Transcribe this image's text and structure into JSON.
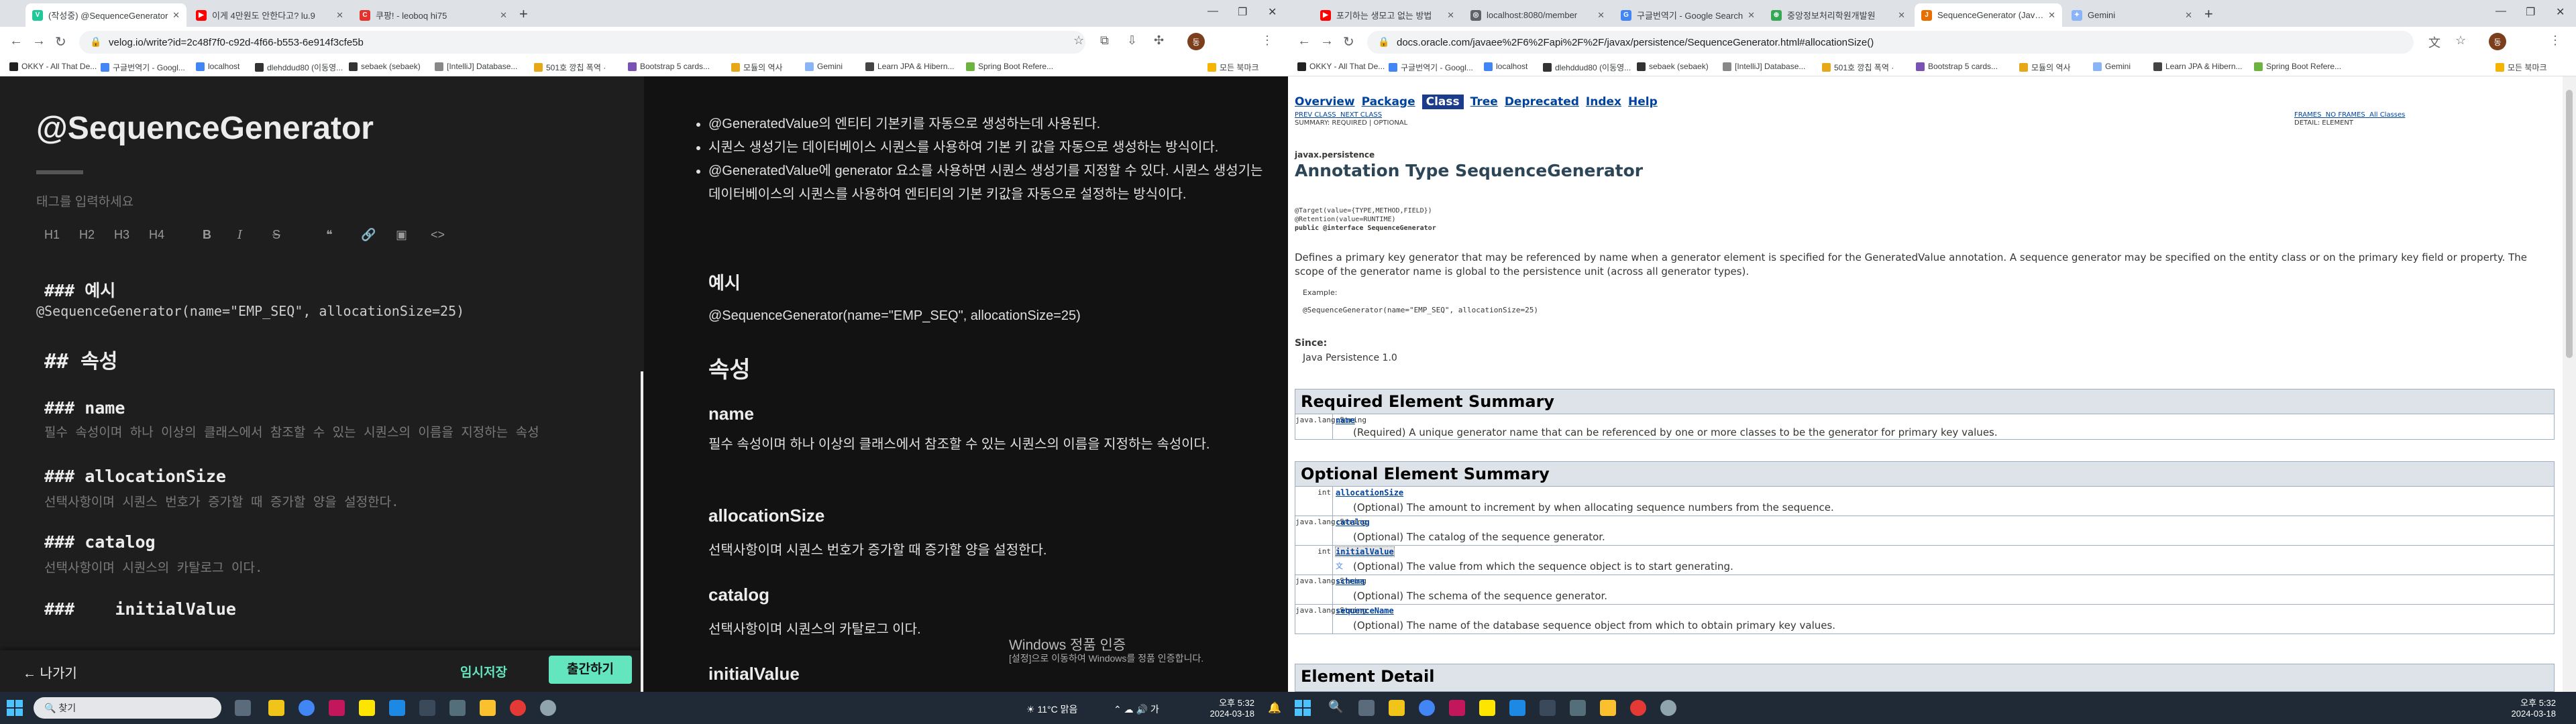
{
  "left": {
    "tabs": [
      {
        "title": "(작성중) @SequenceGenerator",
        "color": "#20c997"
      },
      {
        "title": "이게 4만원도 안한다고? lu.9",
        "color": "#ff0000"
      },
      {
        "title": "쿠팡! - leoboq hi75",
        "color": "#e4332c"
      }
    ],
    "url": "velog.io/write?id=2c48f7f0-c92d-4f66-b553-6e914f3cfe5b",
    "bookmarks": [
      "OKKY - All That De...",
      "구글번역기 - Googl...",
      "localhost",
      "dlehddud80 (이동영...",
      "sebaek (sebaek)",
      "[IntelliJ] Database...",
      "501호 깡칩 폭역 ·",
      "Bootstrap 5 cards...",
      "모듈의 역사",
      "Gemini",
      "Learn JPA & Hibern...",
      "Spring Boot Refere..."
    ],
    "all_bookmarks": "모든 북마크",
    "editor": {
      "title": "@SequenceGenerator",
      "tags_placeholder": "태그를 입력하세요",
      "toolbar": [
        "H1",
        "H2",
        "H3",
        "H4",
        "B",
        "I",
        "S",
        "❝",
        "🔗",
        "▣",
        "<>"
      ],
      "lines": [
        {
          "kind": "h3",
          "text": "### 예시"
        },
        {
          "kind": "code",
          "text": "@SequenceGenerator(name=\"EMP_SEQ\", allocationSize=25)"
        },
        {
          "kind": "h2",
          "text": "## 속성"
        },
        {
          "kind": "h3",
          "text": "### name"
        },
        {
          "kind": "body",
          "text": "필수 속성이며 하나 이상의 클래스에서 참조할 수 있는 시퀀스의 이름을 지정하는 속성"
        },
        {
          "kind": "h3",
          "text": "### allocationSize"
        },
        {
          "kind": "body",
          "text": "선택사항이며 시퀀스 번호가 증가할 때 증가할 양을 설정한다."
        },
        {
          "kind": "h3",
          "text": "### catalog"
        },
        {
          "kind": "body",
          "text": "선택사항이며 시퀀스의 카탈로그 이다."
        },
        {
          "kind": "h3",
          "text": "###    initialValue"
        }
      ],
      "exit": "나가기",
      "save": "임시저장",
      "publish": "출간하기"
    },
    "preview": {
      "bullets": [
        "@GeneratedValue의 엔티티 기본키를 자동으로 생성하는데 사용된다.",
        "시퀀스 생성기는 데이터베이스 시퀀스를 사용하여 기본 키 값을 자동으로 생성하는 방식이다.",
        "@GeneratedValue에 generator 요소를 사용하면 시퀀스 생성기를 지정할 수 있다. 시퀀스 생성기는 데이터베이스의 시퀀스를 사용하여 엔티티의 기본 키값을 자동으로 설정하는 방식이다."
      ],
      "example_heading": "예시",
      "example_code": "@SequenceGenerator(name=\"EMP_SEQ\", allocationSize=25)",
      "attr_heading": "속성",
      "sections": [
        {
          "name": "name",
          "desc": "필수 속성이며 하나 이상의 클래스에서 참조할 수 있는 시퀀스의 이름을 지정하는 속성이다."
        },
        {
          "name": "allocationSize",
          "desc": "선택사항이며 시퀀스 번호가 증가할 때 증가할 양을 설정한다."
        },
        {
          "name": "catalog",
          "desc": "선택사항이며 시퀀스의 카탈로그 이다."
        },
        {
          "name": "initialValue",
          "desc": ""
        }
      ]
    },
    "watermark": [
      "Windows 정품 인증",
      "[설정]으로 이동하여 Windows를 정품 인증합니다."
    ],
    "taskbar": {
      "search": "찾기",
      "weather": "11°C 맑음",
      "time": "오후 5:32",
      "date": "2024-03-18",
      "lang": "가"
    }
  },
  "right": {
    "tabs": [
      {
        "title": "포기하는 생모고 없는 방법",
        "color": "#ff0000"
      },
      {
        "title": "localhost:8080/member",
        "color": "#5f6368"
      },
      {
        "title": "구글번역기 - Google Search",
        "color": "#4285f4"
      },
      {
        "title": "중앙정보처리학원개발원",
        "color": "#34a853"
      },
      {
        "title": "SequenceGenerator (Java EE 6",
        "color": "#e76f00"
      },
      {
        "title": "Gemini",
        "color": "#8ab4f8"
      }
    ],
    "url": "docs.oracle.com/javaee%2F6%2Fapi%2F%2F/javax/persistence/SequenceGenerator.html#allocationSize()",
    "bookmarks": [
      "OKKY - All That De...",
      "구글번역기 - Googl...",
      "localhost",
      "dlehddud80 (이동영...",
      "sebaek (sebaek)",
      "[IntelliJ] Database...",
      "501호 깡칩 폭역 ·",
      "Bootstrap 5 cards...",
      "모듈의 역사",
      "Gemini",
      "Learn JPA & Hibern...",
      "Spring Boot Refere..."
    ],
    "all_bookmarks": "모든 북마크",
    "doc": {
      "nav": [
        "Overview",
        "Package",
        "Class",
        "Tree",
        "Deprecated",
        "Index",
        "Help"
      ],
      "subnav_left": [
        "PREV CLASS",
        "NEXT CLASS"
      ],
      "subnav_frames": [
        "FRAMES",
        "NO FRAMES",
        "All Classes"
      ],
      "summary_line": "SUMMARY: REQUIRED | OPTIONAL",
      "detail_line": "DETAIL: ELEMENT",
      "package": "javax.persistence",
      "title": "Annotation Type SequenceGenerator",
      "decl": [
        "@Target(value={TYPE,METHOD,FIELD})",
        "@Retention(value=RUNTIME)",
        "public @interface SequenceGenerator"
      ],
      "description": "Defines a primary key generator that may be referenced by name when a generator element is specified for the GeneratedValue annotation. A sequence generator may be specified on the entity class or on the primary key field or property. The scope of the generator name is global to the persistence unit (across all generator types).",
      "example_label": "Example:",
      "example_code": "@SequenceGenerator(name=\"EMP_SEQ\", allocationSize=25)",
      "since_label": "Since:",
      "since_value": "Java Persistence 1.0",
      "required_heading": "Required Element Summary",
      "required": [
        {
          "type": "java.lang.String",
          "name": "name",
          "desc": "(Required) A unique generator name that can be referenced by one or more classes to be the generator for primary key values."
        }
      ],
      "optional_heading": "Optional Element Summary",
      "optional": [
        {
          "type": "int",
          "name": "allocationSize",
          "desc": "(Optional) The amount to increment by when allocating sequence numbers from the sequence."
        },
        {
          "type": "java.lang.String",
          "name": "catalog",
          "desc": "(Optional) The catalog of the sequence generator."
        },
        {
          "type": "int",
          "name": "initialValue",
          "desc": "(Optional) The value from which the sequence object is to start generating."
        },
        {
          "type": "java.lang.String",
          "name": "schema",
          "desc": "(Optional) The schema of the sequence generator."
        },
        {
          "type": "java.lang.String",
          "name": "sequenceName",
          "desc": "(Optional) The name of the database sequence object from which to obtain primary key values."
        }
      ],
      "detail_heading": "Element Detail"
    },
    "taskbar": {
      "time": "오후 5:32",
      "date": "2024-03-18"
    }
  }
}
